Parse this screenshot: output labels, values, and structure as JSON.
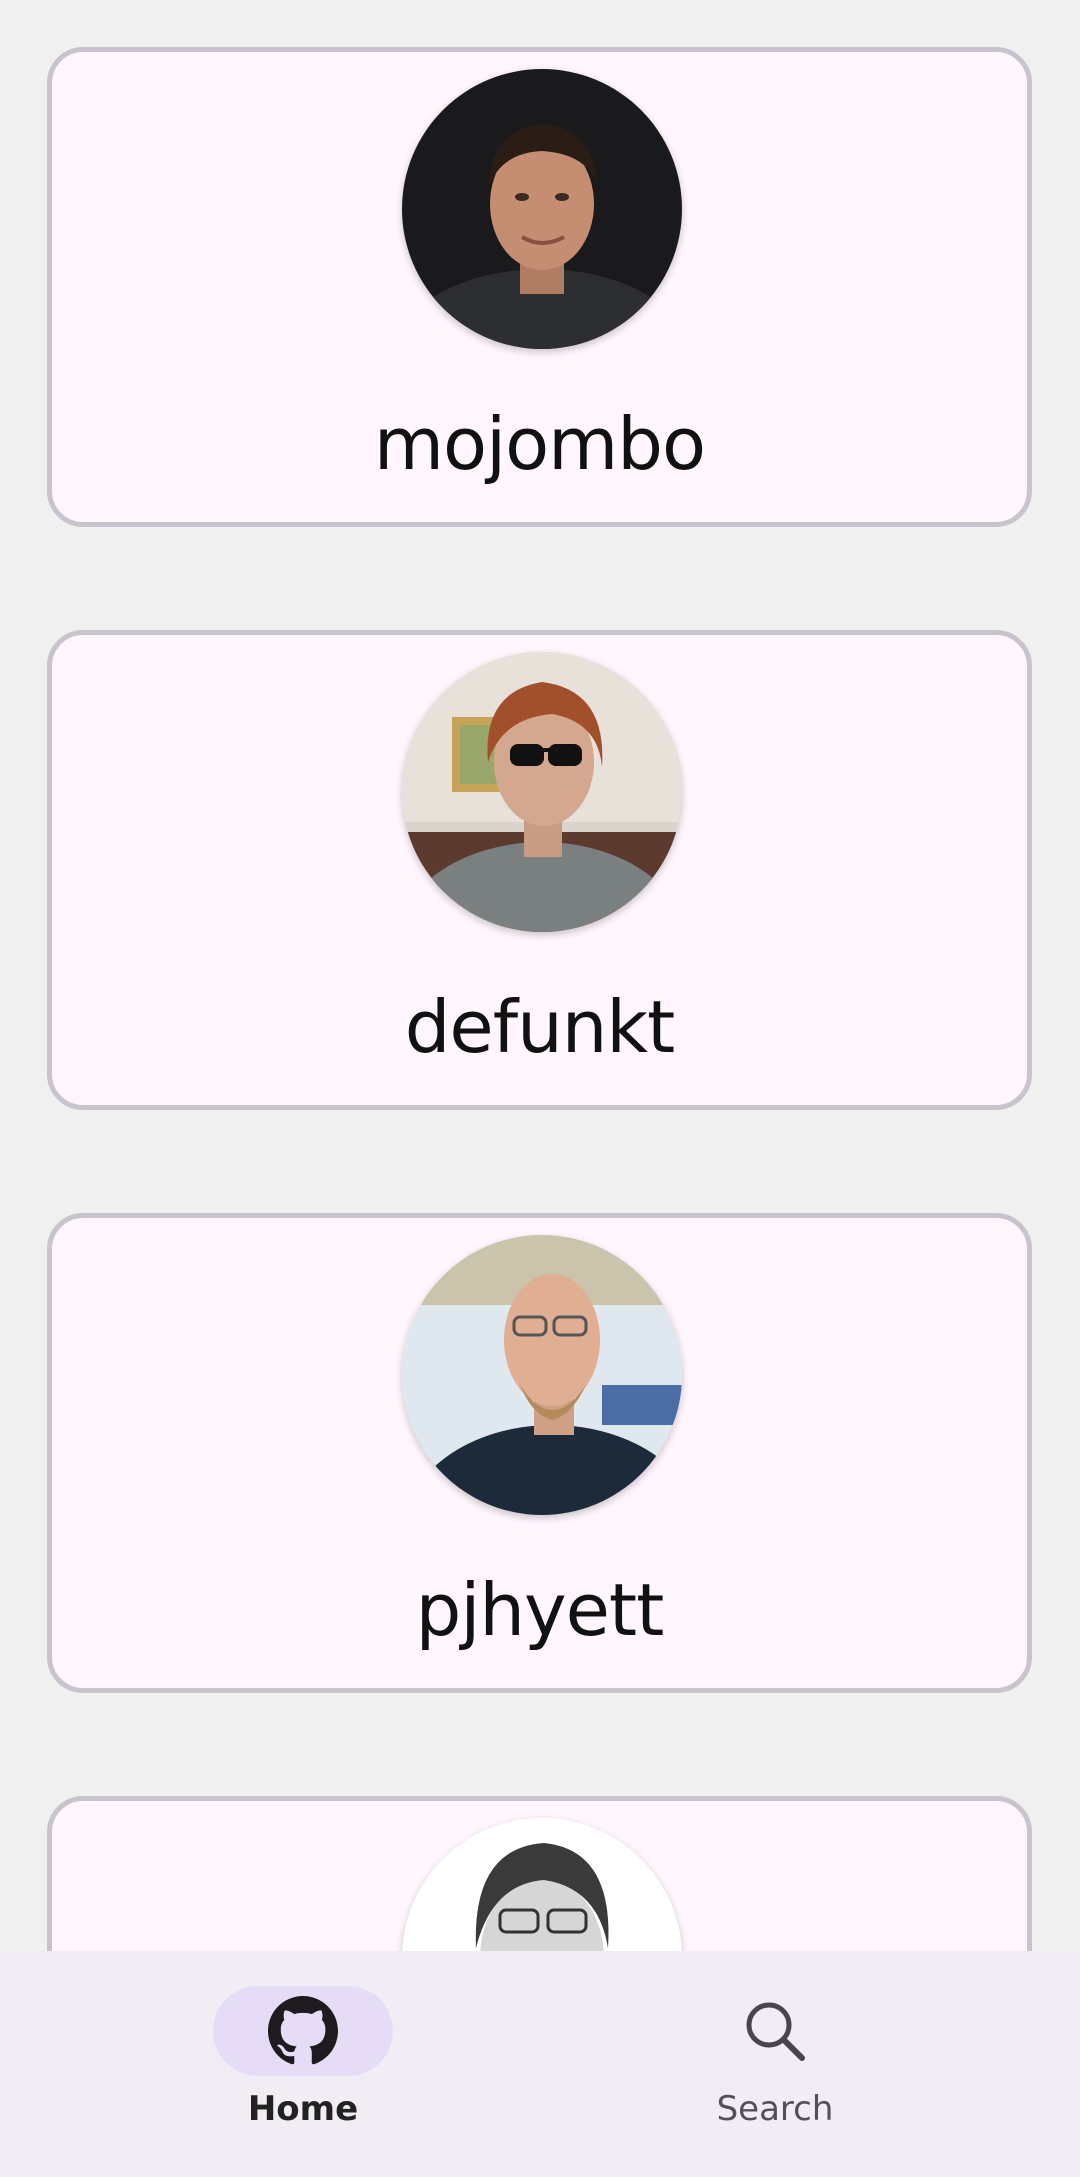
{
  "users": [
    {
      "username": "mojombo"
    },
    {
      "username": "defunkt"
    },
    {
      "username": "pjhyett"
    },
    {
      "username": ""
    }
  ],
  "bottom_nav": {
    "items": [
      {
        "label": "Home",
        "icon": "github-icon",
        "selected": true
      },
      {
        "label": "Search",
        "icon": "search-icon",
        "selected": false
      }
    ]
  },
  "colors": {
    "background": "#f1f0f1",
    "card_background": "#fff7fd",
    "card_border": "#c8c3cc",
    "nav_background": "#f2ecf5",
    "nav_selected_pill": "#e7dcf5"
  }
}
